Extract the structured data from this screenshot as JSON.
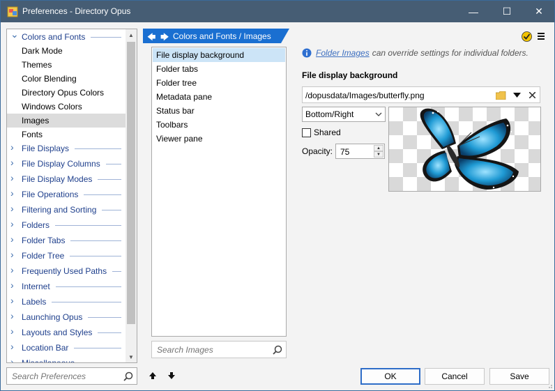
{
  "window": {
    "title": "Preferences - Directory Opus",
    "controls": {
      "minimize": "—",
      "maximize": "☐",
      "close": "✕"
    }
  },
  "sidebar": {
    "items": [
      {
        "label": "Colors and Fonts",
        "expanded": true,
        "level": 0
      },
      {
        "label": "Dark Mode",
        "level": 1
      },
      {
        "label": "Themes",
        "level": 1
      },
      {
        "label": "Color Blending",
        "level": 1
      },
      {
        "label": "Directory Opus Colors",
        "level": 1
      },
      {
        "label": "Windows Colors",
        "level": 1
      },
      {
        "label": "Images",
        "level": 1,
        "selected": true
      },
      {
        "label": "Fonts",
        "level": 1
      },
      {
        "label": "File Displays",
        "level": 0
      },
      {
        "label": "File Display Columns",
        "level": 0
      },
      {
        "label": "File Display Modes",
        "level": 0
      },
      {
        "label": "File Operations",
        "level": 0
      },
      {
        "label": "Filtering and Sorting",
        "level": 0
      },
      {
        "label": "Folders",
        "level": 0
      },
      {
        "label": "Folder Tabs",
        "level": 0
      },
      {
        "label": "Folder Tree",
        "level": 0
      },
      {
        "label": "Frequently Used Paths",
        "level": 0
      },
      {
        "label": "Internet",
        "level": 0
      },
      {
        "label": "Labels",
        "level": 0
      },
      {
        "label": "Launching Opus",
        "level": 0
      },
      {
        "label": "Layouts and Styles",
        "level": 0
      },
      {
        "label": "Location Bar",
        "level": 0
      },
      {
        "label": "Miscellaneous",
        "level": 0
      }
    ],
    "search_placeholder": "Search Preferences"
  },
  "breadcrumb": {
    "text": "Colors and Fonts / Images"
  },
  "middle": {
    "items": [
      {
        "label": "File display background",
        "selected": true
      },
      {
        "label": "Folder tabs"
      },
      {
        "label": "Folder tree"
      },
      {
        "label": "Metadata pane"
      },
      {
        "label": "Status bar"
      },
      {
        "label": "Toolbars"
      },
      {
        "label": "Viewer pane"
      }
    ],
    "search_placeholder": "Search Images"
  },
  "settings": {
    "info_link": "Folder Images",
    "info_text": "can override settings for individual folders.",
    "section_title": "File display background",
    "path_value": "/dopusdata/Images/butterfly.png",
    "position_value": "Bottom/Right",
    "shared_label": "Shared",
    "shared_checked": false,
    "opacity_label": "Opacity:",
    "opacity_value": "75"
  },
  "buttons": {
    "ok": "OK",
    "cancel": "Cancel",
    "save": "Save"
  },
  "colors": {
    "titlebar": "#465d74",
    "accent": "#1a6fd1",
    "link": "#3c6ebf",
    "tree_text": "#1e3f8c"
  }
}
